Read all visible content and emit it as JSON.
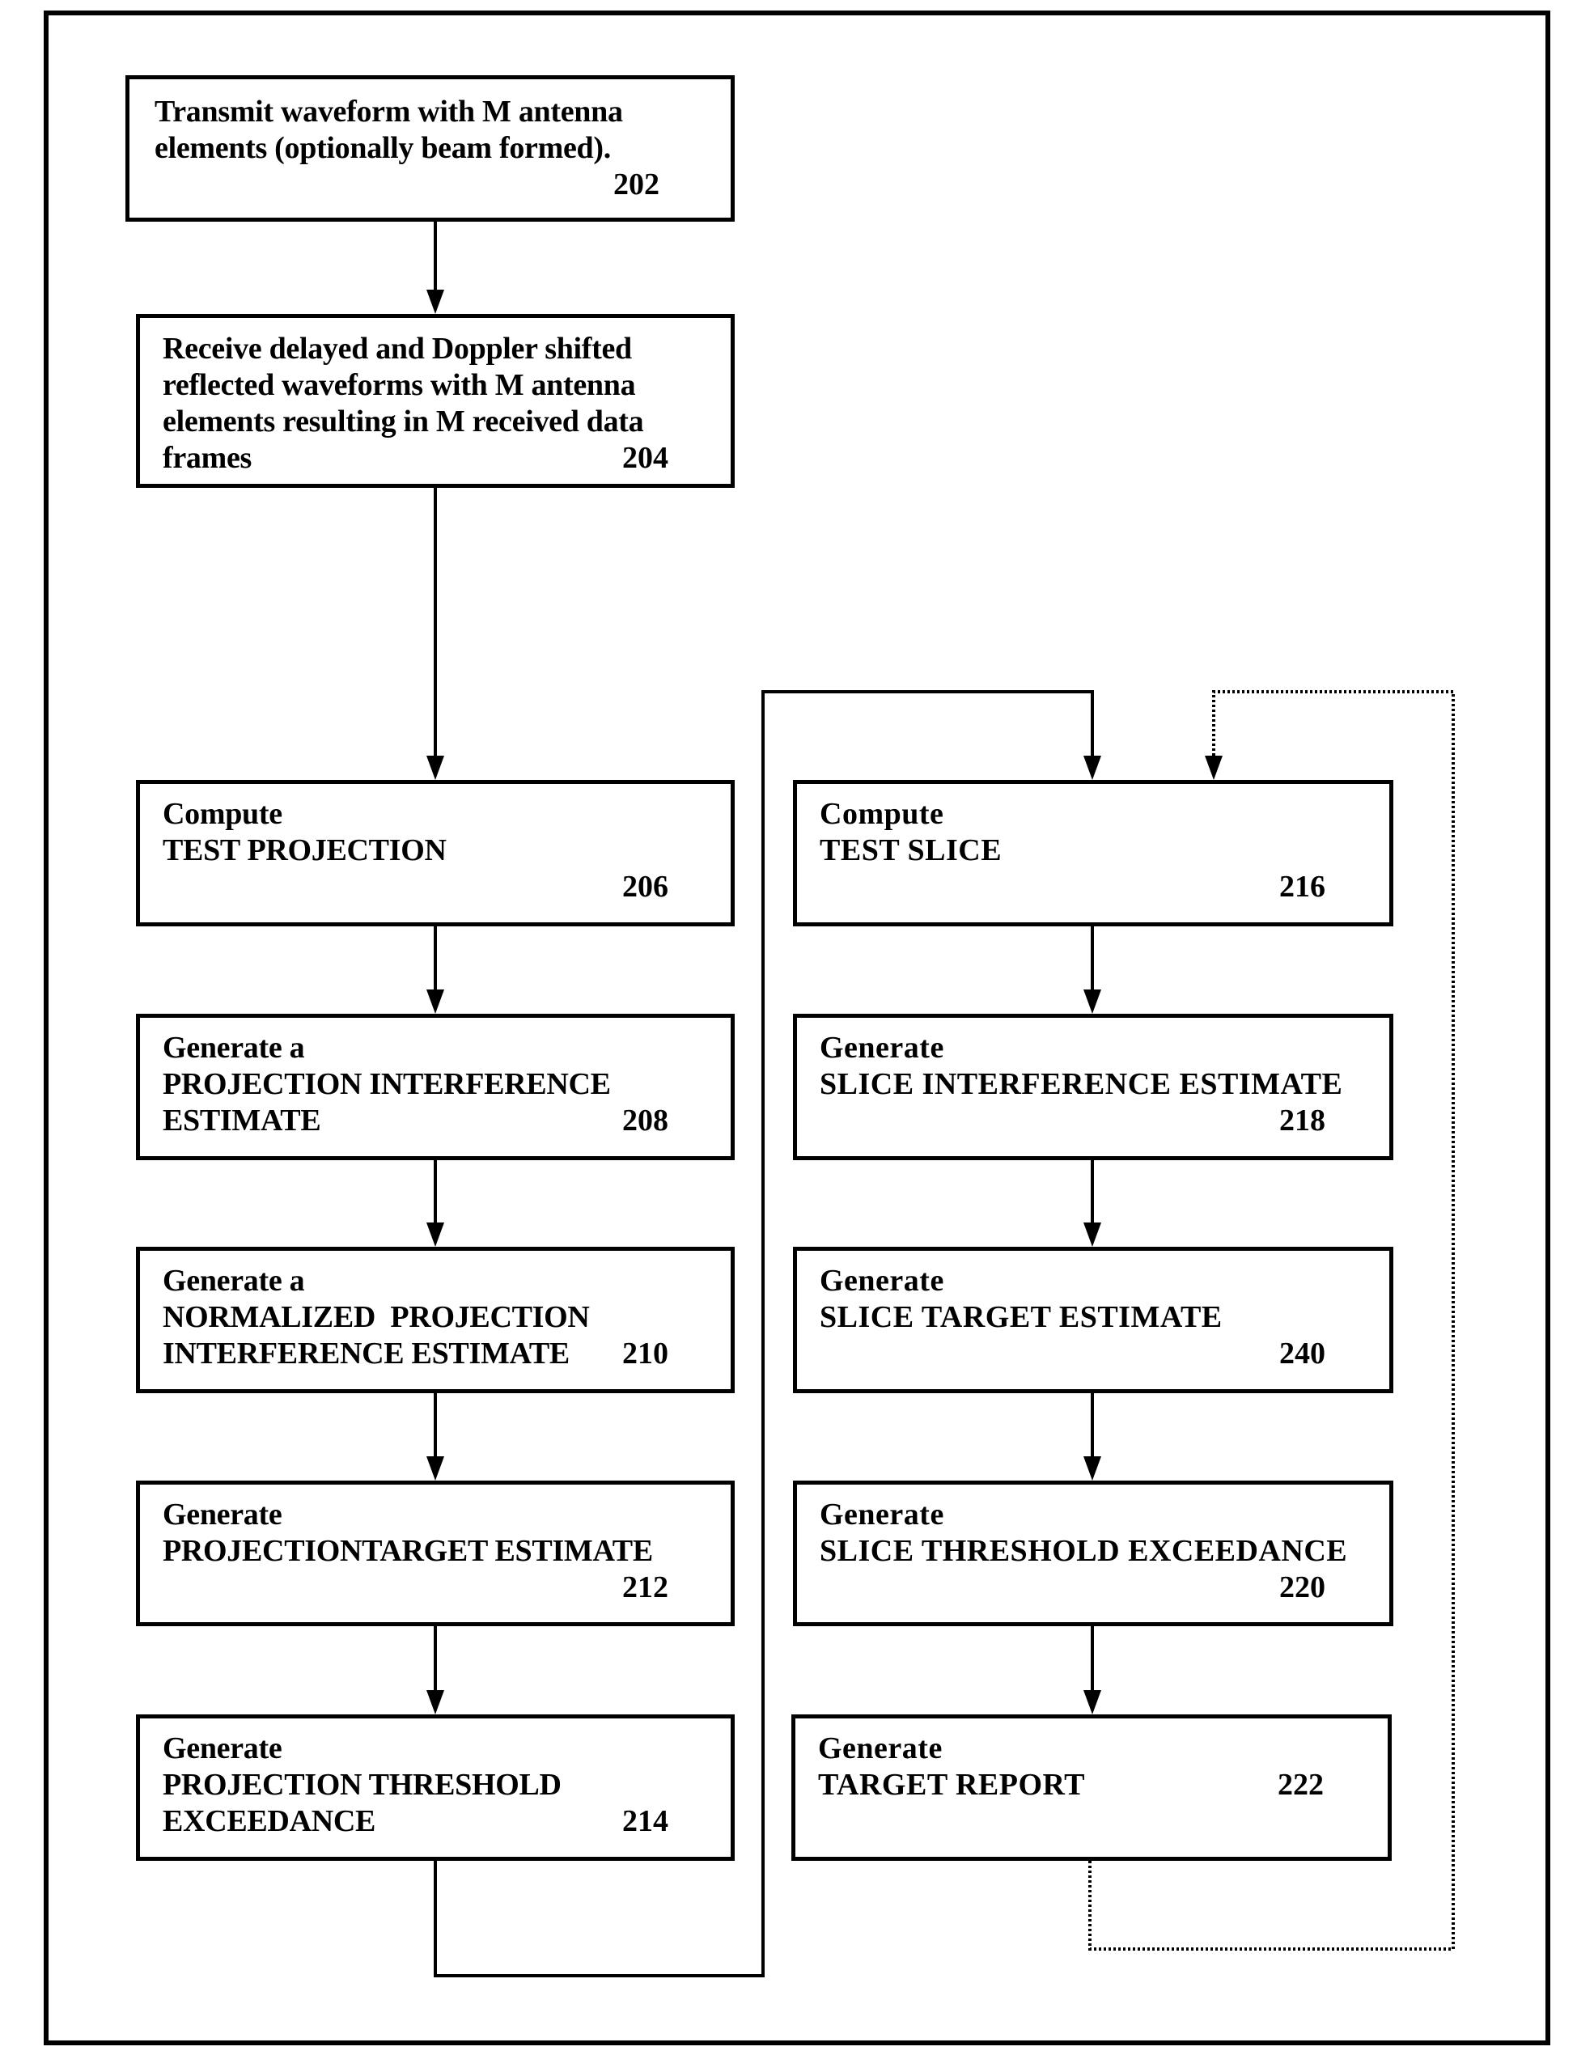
{
  "diagram": {
    "type": "flowchart",
    "colors": {
      "stroke": "#000000",
      "background": "#ffffff"
    },
    "steps": {
      "202": {
        "id": "202",
        "lines": [
          "Transmit waveform with M antenna",
          "elements (optionally beam formed)."
        ],
        "number": "202"
      },
      "204": {
        "id": "204",
        "lines": [
          "Receive delayed and Doppler shifted",
          "reflected waveforms with M antenna",
          "elements resulting in M received data",
          "frames"
        ],
        "number": "204"
      },
      "206": {
        "id": "206",
        "lines": [
          "Compute",
          "TEST PROJECTION"
        ],
        "number": "206"
      },
      "208": {
        "id": "208",
        "lines": [
          "Generate a",
          "PROJECTION INTERFERENCE",
          "ESTIMATE"
        ],
        "number": "208"
      },
      "210": {
        "id": "210",
        "lines": [
          "Generate a",
          "NORMALIZED  PROJECTION",
          "INTERFERENCE ESTIMATE"
        ],
        "number": "210"
      },
      "212": {
        "id": "212",
        "lines": [
          "Generate",
          "PROJECTIONTARGET ESTIMATE"
        ],
        "number": "212"
      },
      "214": {
        "id": "214",
        "lines": [
          "Generate",
          "PROJECTION THRESHOLD",
          "EXCEEDANCE"
        ],
        "number": "214"
      },
      "216": {
        "id": "216",
        "lines": [
          "Compute",
          "TEST SLICE"
        ],
        "number": "216"
      },
      "218": {
        "id": "218",
        "lines": [
          "Generate",
          "SLICE INTERFERENCE ESTIMATE"
        ],
        "number": "218"
      },
      "240": {
        "id": "240",
        "lines": [
          "Generate",
          "SLICE TARGET ESTIMATE"
        ],
        "number": "240"
      },
      "220": {
        "id": "220",
        "lines": [
          "Generate",
          "SLICE THRESHOLD EXCEEDANCE"
        ],
        "number": "220"
      },
      "222": {
        "id": "222",
        "lines": [
          "Generate",
          "TARGET REPORT"
        ],
        "number": "222"
      }
    },
    "edges": [
      {
        "from": "202",
        "to": "204",
        "style": "solid"
      },
      {
        "from": "204",
        "to": "206",
        "style": "solid"
      },
      {
        "from": "206",
        "to": "208",
        "style": "solid"
      },
      {
        "from": "208",
        "to": "210",
        "style": "solid"
      },
      {
        "from": "210",
        "to": "212",
        "style": "solid"
      },
      {
        "from": "212",
        "to": "214",
        "style": "solid"
      },
      {
        "from": "214",
        "to": "216",
        "style": "solid"
      },
      {
        "from": "216",
        "to": "218",
        "style": "solid"
      },
      {
        "from": "218",
        "to": "240",
        "style": "solid"
      },
      {
        "from": "240",
        "to": "220",
        "style": "solid"
      },
      {
        "from": "220",
        "to": "222",
        "style": "solid"
      },
      {
        "from": "222",
        "to": "216",
        "style": "dotted"
      }
    ]
  }
}
